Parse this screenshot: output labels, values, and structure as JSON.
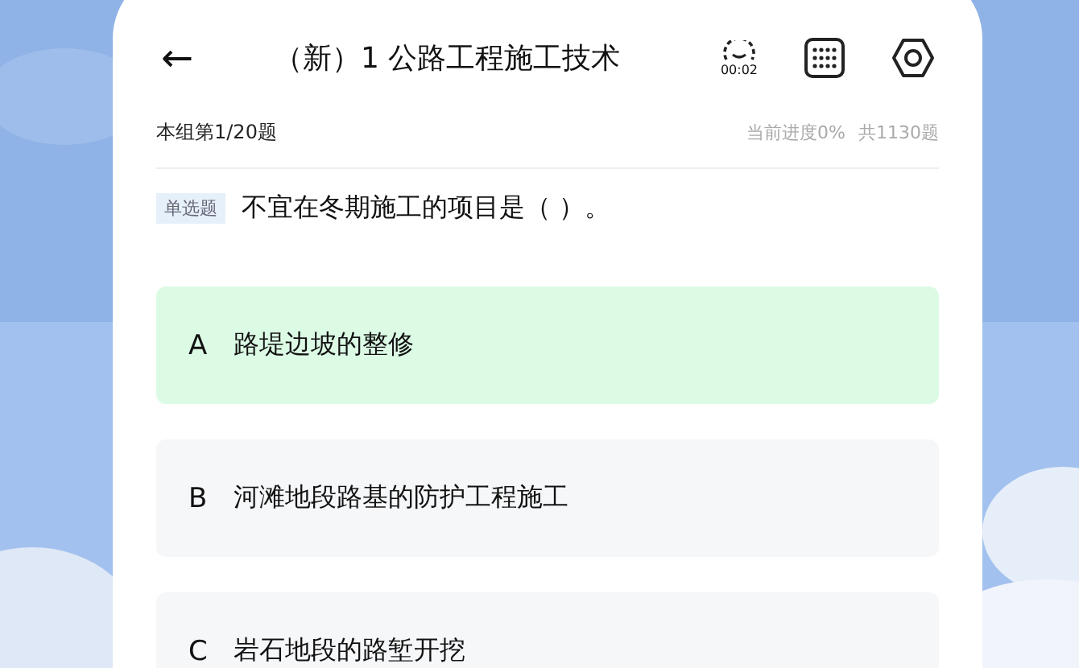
{
  "header": {
    "back": "←",
    "title": "（新）1 公路工程施工技术",
    "timer": "00:02"
  },
  "progress": {
    "group": "本组第1/20题",
    "current": "当前进度0%",
    "total": "共1130题"
  },
  "question": {
    "type_tag": "单选题",
    "text": "不宜在冬期施工的项目是（ ）。"
  },
  "options": [
    {
      "letter": "A",
      "text": "路堤边坡的整修",
      "selected": true
    },
    {
      "letter": "B",
      "text": "河滩地段路基的防护工程施工",
      "selected": false
    },
    {
      "letter": "C",
      "text": "岩石地段的路堑开挖",
      "selected": false
    }
  ]
}
